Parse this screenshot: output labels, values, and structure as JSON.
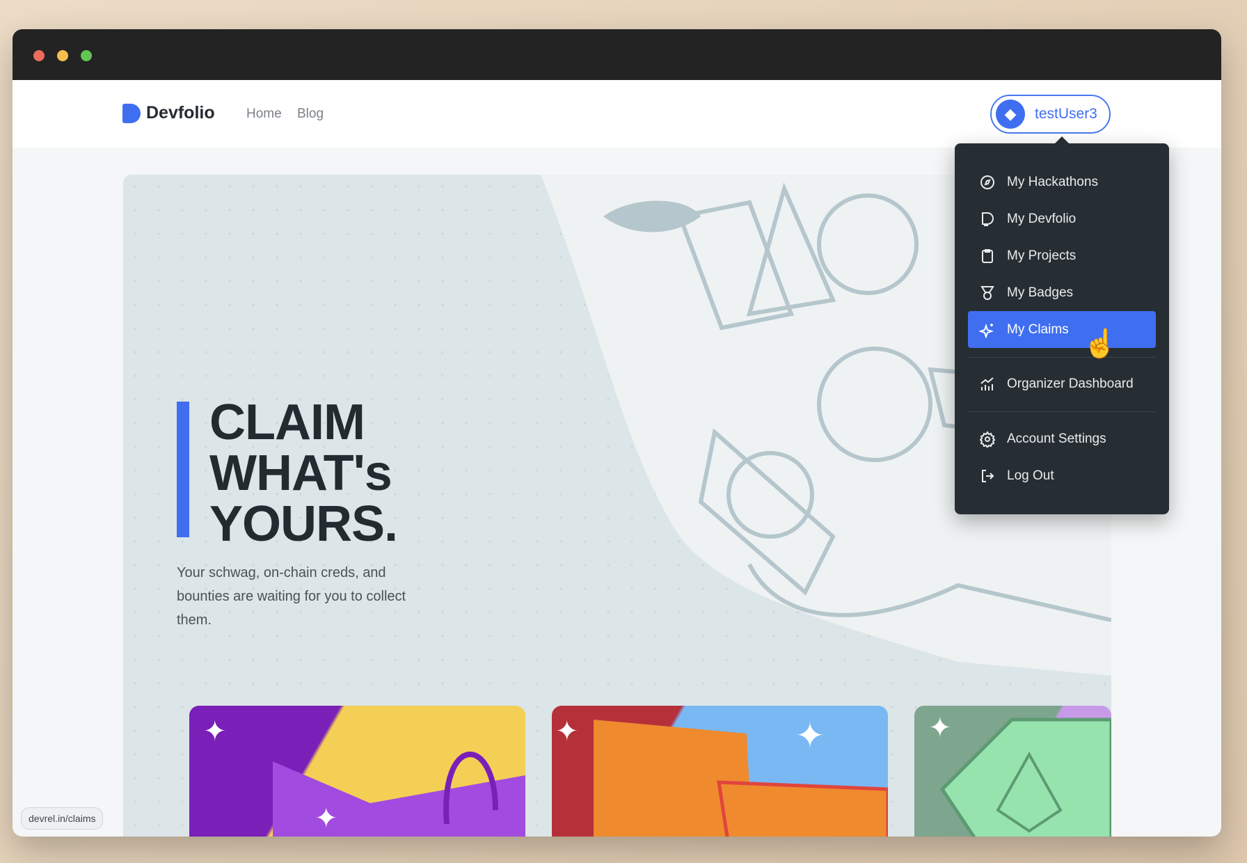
{
  "window": {
    "controls": [
      {
        "name": "close",
        "color": "#ed6a5e"
      },
      {
        "name": "minimize",
        "color": "#f4bf4f"
      },
      {
        "name": "maximize",
        "color": "#61c554"
      }
    ]
  },
  "header": {
    "brand": "Devfolio",
    "nav": [
      "Home",
      "Blog"
    ],
    "user": "testUser3"
  },
  "menu": {
    "items": [
      {
        "label": "My Hackathons",
        "icon": "compass-icon"
      },
      {
        "label": "My Devfolio",
        "icon": "devfolio-icon"
      },
      {
        "label": "My Projects",
        "icon": "clipboard-icon"
      },
      {
        "label": "My Badges",
        "icon": "medal-icon"
      },
      {
        "label": "My Claims",
        "icon": "sparkles-icon",
        "active": true
      },
      {
        "label": "Organizer Dashboard",
        "icon": "chart-icon"
      },
      {
        "label": "Account Settings",
        "icon": "gear-icon"
      },
      {
        "label": "Log Out",
        "icon": "logout-icon"
      }
    ]
  },
  "hero": {
    "heading": [
      "CLAIM",
      "WHAT's",
      "YOURS."
    ],
    "subtitle": "Your schwag, on-chain creds, and bounties are waiting for you to collect them."
  },
  "status_url": "devrel.in/claims",
  "colors": {
    "accent": "#3f6ff0",
    "menu_bg": "#272e33"
  }
}
